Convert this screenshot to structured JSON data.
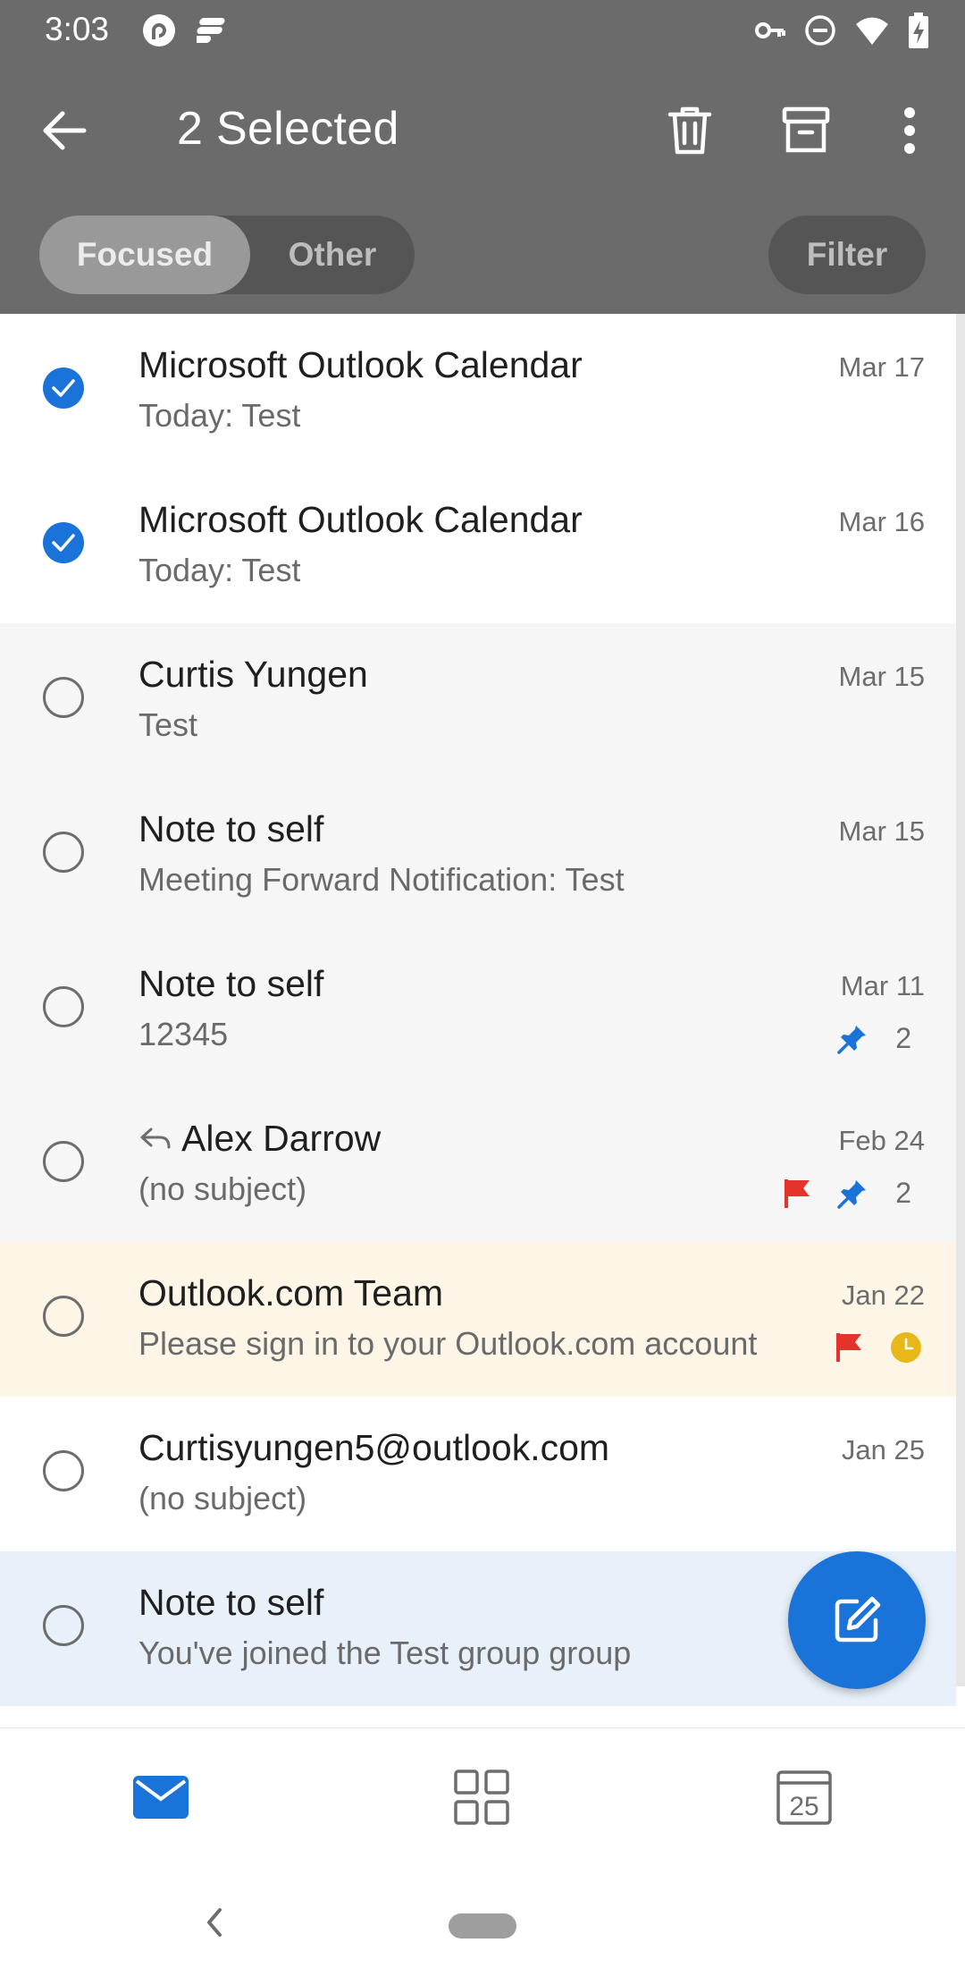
{
  "status_bar": {
    "time": "3:03",
    "left_icons": [
      "pocket-casts-icon",
      "notification-app-icon"
    ],
    "right_icons": [
      "vpn-key-icon",
      "do-not-disturb-icon",
      "wifi-icon",
      "battery-charging-icon"
    ]
  },
  "header": {
    "title": "2 Selected",
    "actions": [
      "back-arrow-icon",
      "delete-icon",
      "archive-icon",
      "more-options-icon"
    ],
    "tabs": [
      {
        "label": "Focused",
        "selected": true
      },
      {
        "label": "Other",
        "selected": false
      }
    ],
    "filter_label": "Filter"
  },
  "colors": {
    "header_bg": "#6b6b6b",
    "accent": "#1a73d8",
    "flag": "#e5322d",
    "clock": "#e8b81b"
  },
  "messages": [
    {
      "sender": "Microsoft Outlook Calendar",
      "subject": "Today: Test",
      "date": "Mar 17",
      "selected": true
    },
    {
      "sender": "Microsoft Outlook Calendar",
      "subject": "Today: Test",
      "date": "Mar 16",
      "selected": true
    },
    {
      "sender": "Curtis Yungen",
      "subject": "Test",
      "date": "Mar 15",
      "selected": false
    },
    {
      "sender": "Note to self",
      "subject": "Meeting Forward Notification: Test",
      "date": "Mar 15",
      "selected": false
    },
    {
      "sender": "Note to self",
      "subject": "12345",
      "date": "Mar 11",
      "selected": false,
      "pinned": true,
      "thread_count": "2"
    },
    {
      "sender": "Alex Darrow",
      "subject": "(no subject)",
      "date": "Feb 24",
      "selected": false,
      "replied": true,
      "flagged": true,
      "pinned": true,
      "thread_count": "2"
    },
    {
      "sender": "Outlook.com Team",
      "subject": "Please sign in to your Outlook.com account",
      "date": "Jan 22",
      "selected": false,
      "flagged": true,
      "scheduled": true
    },
    {
      "sender": "Curtisyungen5@outlook.com",
      "subject": "(no subject)",
      "date": "Jan 25",
      "selected": false
    },
    {
      "sender": "Note to self",
      "subject": "You've joined the Test group group",
      "date": "",
      "selected": false
    }
  ],
  "fab": {
    "icon": "compose-icon"
  },
  "bottom_nav": {
    "items": [
      "mail-icon",
      "apps-grid-icon",
      "calendar-icon"
    ],
    "calendar_day": "25"
  }
}
